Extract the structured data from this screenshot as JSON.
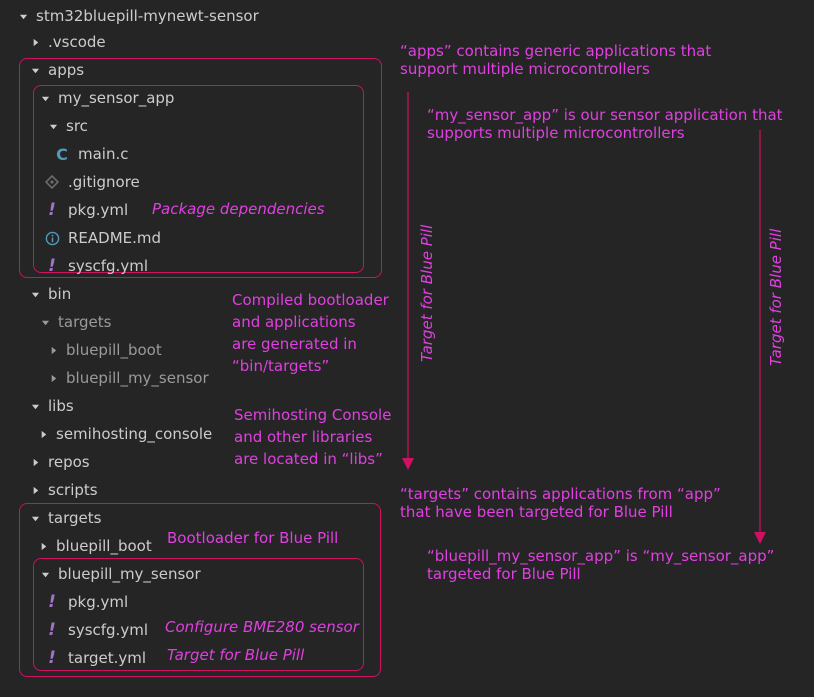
{
  "tree": {
    "root": "stm32bluepill-mynewt-sensor",
    "vscode": ".vscode",
    "apps": "apps",
    "my_sensor_app": "my_sensor_app",
    "src": "src",
    "main_c": "main.c",
    "gitignore": ".gitignore",
    "app_pkg_yml": "pkg.yml",
    "readme": "README.md",
    "app_syscfg_yml": "syscfg.yml",
    "bin": "bin",
    "bin_targets": "targets",
    "bin_bluepill_boot": "bluepill_boot",
    "bin_bluepill_my_sensor": "bluepill_my_sensor",
    "libs": "libs",
    "semihosting_console": "semihosting_console",
    "repos": "repos",
    "scripts": "scripts",
    "targets": "targets",
    "t_bluepill_boot": "bluepill_boot",
    "t_bluepill_my_sensor": "bluepill_my_sensor",
    "t_pkg_yml": "pkg.yml",
    "t_syscfg_yml": "syscfg.yml",
    "t_target_yml": "target.yml"
  },
  "annotations": {
    "apps_desc": [
      "“apps” contains generic applications that",
      "support multiple microcontrollers"
    ],
    "my_sensor_app_desc": [
      "“my_sensor_app” is our sensor application that",
      "supports multiple microcontrollers"
    ],
    "pkg_deps": "Package dependencies",
    "bin_desc": [
      "Compiled bootloader",
      "and applications",
      "are generated in",
      "“bin/targets”"
    ],
    "libs_desc": [
      "Semihosting Console",
      "and other libraries",
      "are located in “libs”"
    ],
    "targets_desc": [
      "“targets” contains applications from “app”",
      "that have been targeted for Blue Pill"
    ],
    "bootloader": "Bootloader for Blue Pill",
    "bluepill_my_sensor_desc": [
      "“bluepill_my_sensor_app” is “my_sensor_app”",
      "targeted for Blue Pill"
    ],
    "configure_bme": "Configure BME280 sensor",
    "target_for_bp": "Target for Blue Pill",
    "vertical_left": "Target for Blue Pill",
    "vertical_right": "Target for Blue Pill"
  },
  "icons": {
    "c_glyph": "C",
    "yml_glyph": "!"
  },
  "colors": {
    "background": "#252526",
    "text": "#cccccc",
    "annotation": "#e040e0",
    "box_border": "#d01060",
    "c_icon": "#519aba",
    "yml_icon": "#a074c4"
  }
}
